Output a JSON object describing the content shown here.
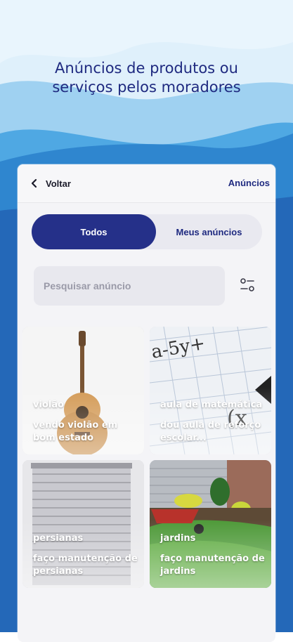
{
  "header": {
    "line1": "Anúncios de produtos ou",
    "line2": "serviços pelos moradores"
  },
  "topbar": {
    "back_label": "Voltar",
    "title": "Anúncios"
  },
  "tabs": {
    "all": "Todos",
    "mine": "Meus anúncios"
  },
  "search": {
    "placeholder": "Pesquisar anúncio"
  },
  "colors": {
    "accent": "#253089",
    "headline": "#1f2a80"
  },
  "ads": [
    {
      "title": "violão",
      "description": "vendo violão em bom estado",
      "image": "guitar-image"
    },
    {
      "title": "aula de matemática",
      "description": "dou aula de reforço escolar...",
      "image": "math-board-image"
    },
    {
      "title": "persianas",
      "description": "faço manutenção de persianas",
      "image": "blinds-image"
    },
    {
      "title": "jardins",
      "description": "faço manutenção de jardins",
      "image": "garden-image"
    }
  ]
}
